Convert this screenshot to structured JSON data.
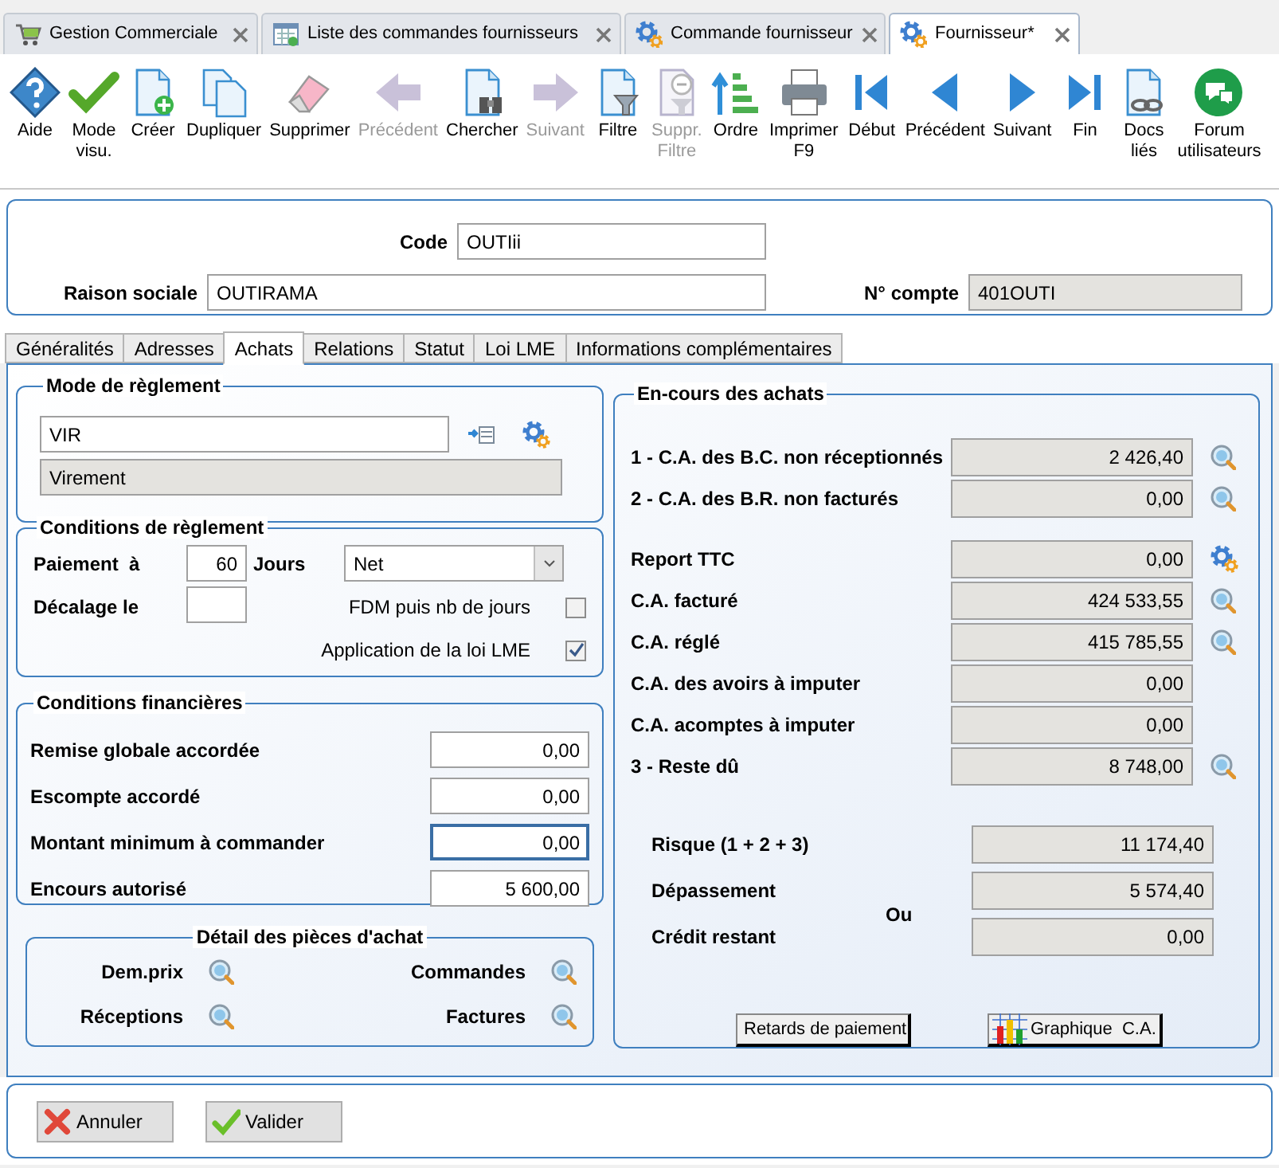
{
  "doc_tabs": [
    {
      "label": "Gestion Commerciale",
      "selected": false
    },
    {
      "label": "Liste des commandes fournisseurs",
      "selected": false
    },
    {
      "label": "Commande fournisseur",
      "selected": false
    },
    {
      "label": "Fournisseur*",
      "selected": true
    }
  ],
  "toolbar": [
    {
      "label": "Aide",
      "disabled": false
    },
    {
      "label": "Mode\nvisu.",
      "disabled": false
    },
    {
      "label": "Créer",
      "disabled": false
    },
    {
      "label": "Dupliquer",
      "disabled": false
    },
    {
      "label": "Supprimer",
      "disabled": false
    },
    {
      "label": "Précédent",
      "disabled": true
    },
    {
      "label": "Chercher",
      "disabled": false
    },
    {
      "label": "Suivant",
      "disabled": true
    },
    {
      "label": "Filtre",
      "disabled": false
    },
    {
      "label": "Suppr.\nFiltre",
      "disabled": true
    },
    {
      "label": "Ordre",
      "disabled": false
    },
    {
      "label": "Imprimer\nF9",
      "disabled": false
    },
    {
      "label": "Début",
      "disabled": false
    },
    {
      "label": "Précédent",
      "disabled": false
    },
    {
      "label": "Suivant",
      "disabled": false
    },
    {
      "label": "Fin",
      "disabled": false
    },
    {
      "label": "Docs\nliés",
      "disabled": false
    },
    {
      "label": "Forum\nutilisateurs",
      "disabled": false
    }
  ],
  "header": {
    "code_label": "Code",
    "code": "OUTIii",
    "name_label": "Raison sociale",
    "name": "OUTIRAMA",
    "account_label": "N° compte",
    "account": "401OUTI"
  },
  "form_tabs": [
    {
      "label": "Généralités",
      "selected": false
    },
    {
      "label": "Adresses",
      "selected": false
    },
    {
      "label": "Achats",
      "selected": true
    },
    {
      "label": "Relations",
      "selected": false
    },
    {
      "label": "Statut",
      "selected": false
    },
    {
      "label": "Loi LME",
      "selected": false
    },
    {
      "label": "Informations complémentaires",
      "selected": false
    }
  ],
  "payment_mode": {
    "title": "Mode de règlement",
    "code": "VIR",
    "description": "Virement"
  },
  "payment_terms": {
    "title": "Conditions de règlement",
    "payment_label": "Paiement  à",
    "days": "60",
    "days_label": "Jours",
    "term": "Net",
    "offset_label": "Décalage le",
    "options": [
      {
        "label": "FDM puis nb de jours",
        "checked": false
      },
      {
        "label": "Application de la loi LME",
        "checked": true
      }
    ]
  },
  "financial": {
    "title": "Conditions financières",
    "rows": [
      {
        "label": "Remise globale accordée",
        "value": "0,00",
        "focused": false
      },
      {
        "label": "Escompte accordé",
        "value": "0,00",
        "focused": false
      },
      {
        "label": "Montant minimum à commander",
        "value": "0,00",
        "focused": true
      },
      {
        "label": "Encours autorisé",
        "value": "5 600,00",
        "focused": false
      }
    ]
  },
  "documents": {
    "title": "Détail des pièces d'achat",
    "items": [
      {
        "label": "Dem.prix"
      },
      {
        "label": "Commandes"
      },
      {
        "label": "Réceptions"
      },
      {
        "label": "Factures"
      }
    ]
  },
  "outstanding": {
    "title": "En-cours des achats",
    "groups": [
      [
        {
          "label": "1 - C.A. des B.C. non réceptionnés",
          "value": "2 426,40",
          "kind": "detail"
        },
        {
          "label": "2 - C.A. des B.R. non facturés",
          "value": "0,00",
          "kind": "detail"
        }
      ],
      [
        {
          "label": "Report TTC",
          "value": "0,00",
          "kind": "settings"
        },
        {
          "label": "C.A. facturé",
          "value": "424 533,55",
          "kind": "detail"
        },
        {
          "label": "C.A. réglé",
          "value": "415 785,55",
          "kind": "detail"
        },
        {
          "label": "C.A. des avoirs à imputer",
          "value": "0,00",
          "kind": "plain"
        },
        {
          "label": "C.A. acomptes à imputer",
          "value": "0,00",
          "kind": "plain"
        },
        {
          "label": "3 - Reste dû",
          "value": "8 748,00",
          "kind": "detail"
        }
      ]
    ],
    "risk": [
      {
        "label": "Risque (1 + 2 + 3)",
        "value": "11 174,40"
      },
      {
        "label": "Dépassement",
        "value": "5 574,40"
      },
      {
        "label": "Crédit restant",
        "value": "0,00"
      }
    ],
    "or_label": "Ou",
    "buttons": [
      {
        "label": "Retards de paiement",
        "kind": "timer"
      },
      {
        "label": "Graphique  C.A.",
        "kind": "chart"
      }
    ]
  },
  "footer_buttons": [
    {
      "label": "Annuler",
      "kind": "cancel"
    },
    {
      "label": "Valider",
      "kind": "confirm"
    }
  ]
}
